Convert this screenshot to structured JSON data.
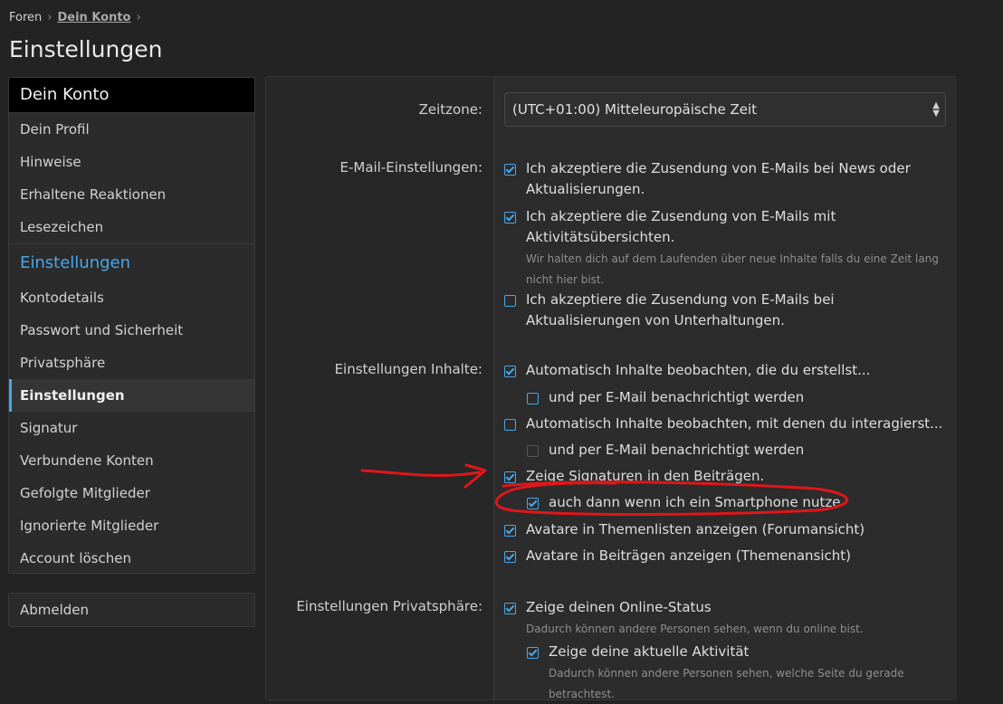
{
  "breadcrumb": {
    "root": "Foren",
    "current": "Dein Konto"
  },
  "page_title": "Einstellungen",
  "sidebar": {
    "header": "Dein Konto",
    "items_top": [
      "Dein Profil",
      "Hinweise",
      "Erhaltene Reaktionen",
      "Lesezeichen"
    ],
    "section": "Einstellungen",
    "items_bottom": [
      "Kontodetails",
      "Passwort und Sicherheit",
      "Privatsphäre",
      "Einstellungen",
      "Signatur",
      "Verbundene Konten",
      "Gefolgte Mitglieder",
      "Ignorierte Mitglieder",
      "Account löschen"
    ],
    "active": "Einstellungen",
    "logout": "Abmelden"
  },
  "form": {
    "timezone_label": "Zeitzone:",
    "timezone_value": "(UTC+01:00) Mitteleuropäische Zeit",
    "email_label": "E-Mail-Einstellungen:",
    "email_news": "Ich akzeptiere die Zusendung von E-Mails bei News oder Aktualisierungen.",
    "email_activity": "Ich akzeptiere die Zusendung von E-Mails mit Aktivitätsübersichten.",
    "email_activity_hint": "Wir halten dich auf dem Laufenden über neue Inhalte falls du eine Zeit lang nicht hier bist.",
    "email_conversations": "Ich akzeptiere die Zusendung von E-Mails bei Aktualisierungen von Unterhaltungen.",
    "content_label": "Einstellungen Inhalte:",
    "watch_created": "Automatisch Inhalte beobachten, die du erstellst...",
    "watch_created_email": "und per E-Mail benachrichtigt werden",
    "watch_interacted": "Automatisch Inhalte beobachten, mit denen du interagierst...",
    "watch_interacted_email": "und per E-Mail benachrichtigt werden",
    "show_signatures": "Zeige Signaturen in den Beiträgen.",
    "show_signatures_mobile": "auch dann wenn ich ein Smartphone nutze",
    "avatars_threadlist": "Avatare in Themenlisten anzeigen (Forumansicht)",
    "avatars_posts": "Avatare in Beiträgen anzeigen (Themenansicht)",
    "privacy_label": "Einstellungen Privatsphäre:",
    "online_status": "Zeige deinen Online-Status",
    "online_status_hint": "Dadurch können andere Personen sehen, wenn du online bist.",
    "current_activity": "Zeige deine aktuelle Aktivität",
    "current_activity_hint": "Dadurch können andere Personen sehen, welche Seite du gerade betrachtest."
  },
  "colors": {
    "accent": "#47a7eb",
    "annotation": "#e0161a",
    "background": "#232323"
  }
}
